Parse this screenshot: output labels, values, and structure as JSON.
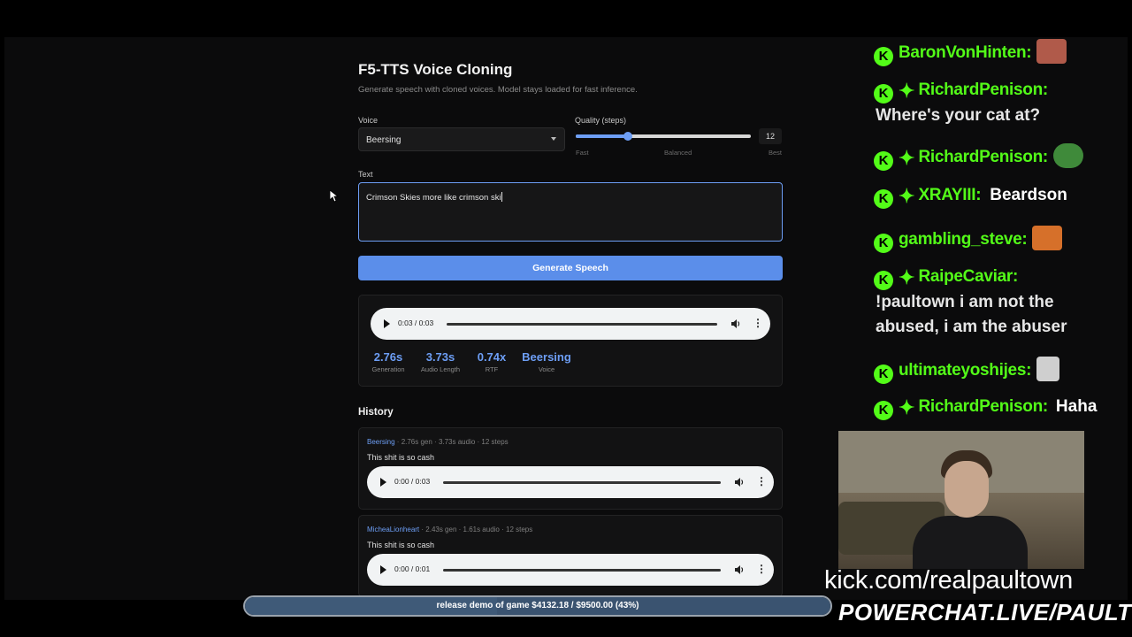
{
  "app": {
    "title": "F5-TTS Voice Cloning",
    "subtitle": "Generate speech with cloned voices. Model stays loaded for fast inference."
  },
  "form": {
    "voice_label": "Voice",
    "voice_value": "Beersing",
    "quality_label": "Quality (steps)",
    "quality_value": "12",
    "quality_fraction": 0.3,
    "tick_fast": "Fast",
    "tick_balanced": "Balanced",
    "tick_best": "Best",
    "text_label": "Text",
    "text_value": "Crimson Skies more like crimson ski",
    "generate_label": "Generate Speech"
  },
  "result": {
    "player_time": "0:03 / 0:03",
    "progress": 1.0,
    "stats": [
      {
        "value": "2.76s",
        "label": "Generation"
      },
      {
        "value": "3.73s",
        "label": "Audio Length"
      },
      {
        "value": "0.74x",
        "label": "RTF"
      },
      {
        "value": "Beersing",
        "label": "Voice"
      }
    ]
  },
  "history": {
    "title": "History",
    "items": [
      {
        "voice": "Beersing",
        "meta": " · 2.76s gen · 3.73s audio · 12 steps",
        "text": "This shit is so cash",
        "time": "0:00 / 0:03"
      },
      {
        "voice": "MicheaLionheart",
        "meta": " · 2.43s gen · 1.61s audio · 12 steps",
        "text": "This shit is so cash",
        "time": "0:00 / 0:01"
      }
    ]
  },
  "chat": {
    "badge_glyph": "K",
    "messages": [
      {
        "user": "BaronVonHinten:",
        "text": "",
        "emote": true,
        "sparkle": false,
        "text_newline": false
      },
      {
        "user": "RichardPenison:",
        "text": "Where's your cat at?",
        "emote": false,
        "sparkle": true,
        "text_newline": true
      },
      {
        "user": "RichardPenison:",
        "text": "",
        "emote": true,
        "sparkle": true,
        "text_newline": false
      },
      {
        "user": "XRAYIII:",
        "text": "Beardson",
        "emote": false,
        "sparkle": true,
        "text_newline": false
      },
      {
        "user": "gambling_steve:",
        "text": "",
        "emote": true,
        "sparkle": false,
        "text_newline": false
      },
      {
        "user": "RaipeCaviar:",
        "text": "!paultown i am not the",
        "text2": "abused, i am the abuser",
        "emote": false,
        "sparkle": true,
        "text_newline": true
      },
      {
        "user": "ultimateyoshijes:",
        "text": "",
        "emote": true,
        "sparkle": false,
        "text_newline": false
      },
      {
        "user": "RichardPenison:",
        "text": "Haha",
        "emote": false,
        "sparkle": true,
        "text_newline": false
      }
    ]
  },
  "overlay": {
    "kick_url": "kick.com/realpaultown",
    "powerchat": "POWERCHAT.LIVE/PAULTOWN",
    "goal_text": "release demo of game $4132.18 / $9500.00 (43%)",
    "goal_fraction": 0.43
  },
  "colors": {
    "accent": "#5b8eea",
    "kick_green": "#53fc18"
  }
}
